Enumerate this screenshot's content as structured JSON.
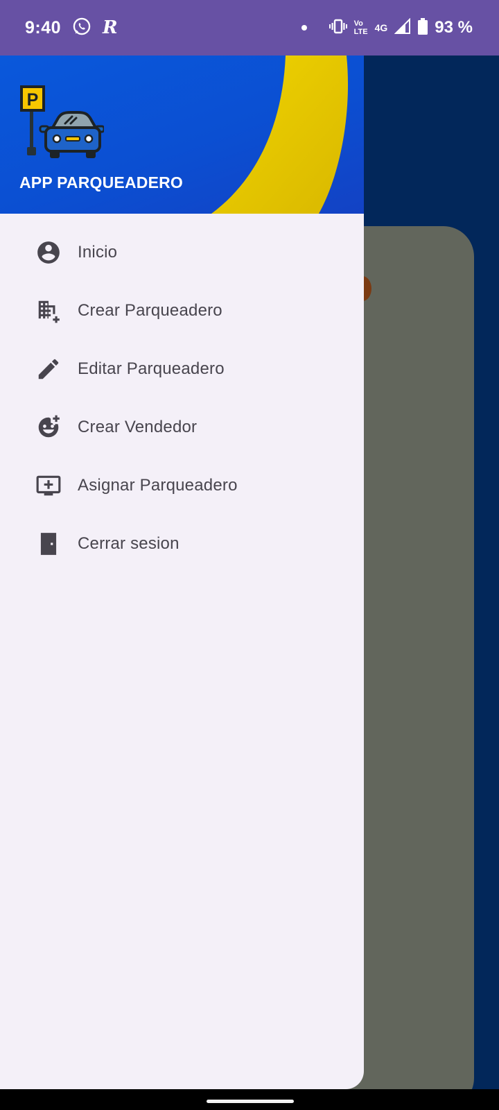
{
  "status_bar": {
    "time": "9:40",
    "battery": "93 %",
    "volte_top": "Vo",
    "volte_bottom": "LTE",
    "network": "4G",
    "icons": [
      "whatsapp-icon",
      "r-app-icon",
      "notification-dot-icon",
      "vibrate-icon",
      "signal-icon",
      "battery-icon"
    ]
  },
  "drawer": {
    "header": {
      "title": "APP PARQUEADERO",
      "logo": "parking-car-logo",
      "logo_letter": "P"
    },
    "items": [
      {
        "label": "Inicio",
        "icon": "account-circle-icon"
      },
      {
        "label": "Crear Parqueadero",
        "icon": "add-business-icon"
      },
      {
        "label": "Editar Parqueadero",
        "icon": "pencil-icon"
      },
      {
        "label": "Crear Vendedor",
        "icon": "add-reaction-icon"
      },
      {
        "label": "Asignar Parqueadero",
        "icon": "add-to-queue-icon"
      },
      {
        "label": "Cerrar sesion",
        "icon": "door-icon"
      }
    ]
  },
  "colors": {
    "status_bar": "#6751a4",
    "header_blue": "#0a58db",
    "header_yellow": "#e6c800",
    "drawer_bg": "#f4f0f8",
    "menu_text": "#48454e",
    "background": "#02275a",
    "scrim_card": "#62665c"
  }
}
